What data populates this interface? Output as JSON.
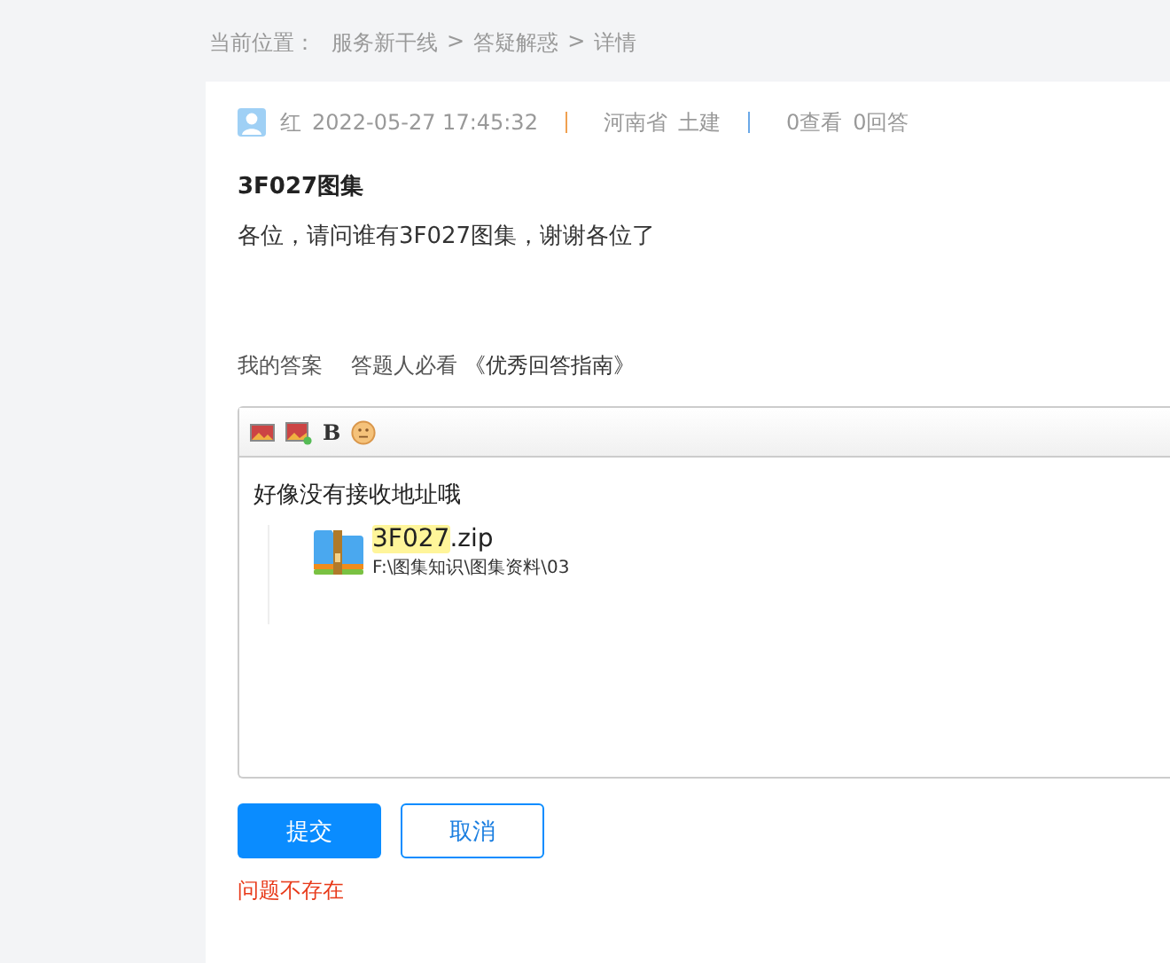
{
  "breadcrumb": {
    "label": "当前位置：",
    "items": [
      "服务新干线",
      "答疑解惑",
      "详情"
    ],
    "separator": ">"
  },
  "question": {
    "author": "红",
    "time": "2022-05-27 17:45:32",
    "region": "河南省",
    "category": "土建",
    "views": "0查看",
    "answers": "0回答",
    "title": "3F027图集",
    "body": "各位，请问谁有3F027图集，谢谢各位了"
  },
  "answer_links": [
    {
      "text": "我的答案",
      "kind": "plain"
    },
    {
      "text": "答题人必看",
      "kind": "plain"
    },
    {
      "text": "《优秀回答指南》",
      "kind": "link"
    }
  ],
  "editor": {
    "toolbar": [
      {
        "kind": "image"
      },
      {
        "kind": "image-add"
      },
      {
        "kind": "bold",
        "text": "B"
      },
      {
        "kind": "emoji"
      }
    ],
    "text": "好像没有接收地址哦",
    "attachment": {
      "highlight": "3F027",
      "name_rest": ".zip",
      "path": "F:\\图集知识\\图集资料\\03"
    }
  },
  "buttons": [
    {
      "label": "提交",
      "kind": "primary"
    },
    {
      "label": "取消",
      "kind": "secondary"
    }
  ],
  "error": "问题不存在"
}
